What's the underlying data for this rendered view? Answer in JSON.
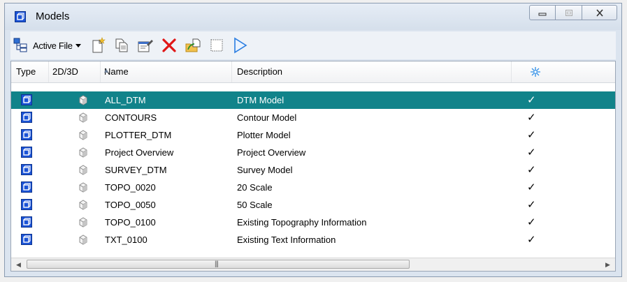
{
  "window": {
    "title": "Models",
    "title_icon": "model-icon",
    "controls": [
      "minimize-icon",
      "maximize-icon",
      "close-icon"
    ]
  },
  "toolbar": {
    "filter_label": "Active File",
    "buttons": [
      {
        "name": "new-model-icon"
      },
      {
        "name": "copy-model-icon"
      },
      {
        "name": "edit-properties-icon"
      },
      {
        "name": "delete-icon"
      },
      {
        "name": "import-icon"
      },
      {
        "name": "boundary-icon"
      },
      {
        "name": "view-icon"
      }
    ]
  },
  "columns": {
    "type": "Type",
    "dim": "2D/3D",
    "name": "Name",
    "description": "Description",
    "display_icon": "display-column-icon"
  },
  "rows": [
    {
      "name": "ALL_DTM",
      "description": "DTM Model",
      "check": "✓",
      "selected": true
    },
    {
      "name": "CONTOURS",
      "description": "Contour Model",
      "check": "✓"
    },
    {
      "name": "PLOTTER_DTM",
      "description": "Plotter Model",
      "check": "✓"
    },
    {
      "name": "Project Overview",
      "description": "Project Overview",
      "check": "✓"
    },
    {
      "name": "SURVEY_DTM",
      "description": "Survey Model",
      "check": "✓"
    },
    {
      "name": "TOPO_0020",
      "description": "20 Scale",
      "check": "✓"
    },
    {
      "name": "TOPO_0050",
      "description": "50 Scale",
      "check": "✓"
    },
    {
      "name": "TOPO_0100",
      "description": "Existing Topography Information",
      "check": "✓"
    },
    {
      "name": "TXT_0100",
      "description": "Existing Text Information",
      "check": "✓"
    }
  ],
  "colors": {
    "selected_row": "#11838a",
    "model_icon": "#1b53d6"
  }
}
